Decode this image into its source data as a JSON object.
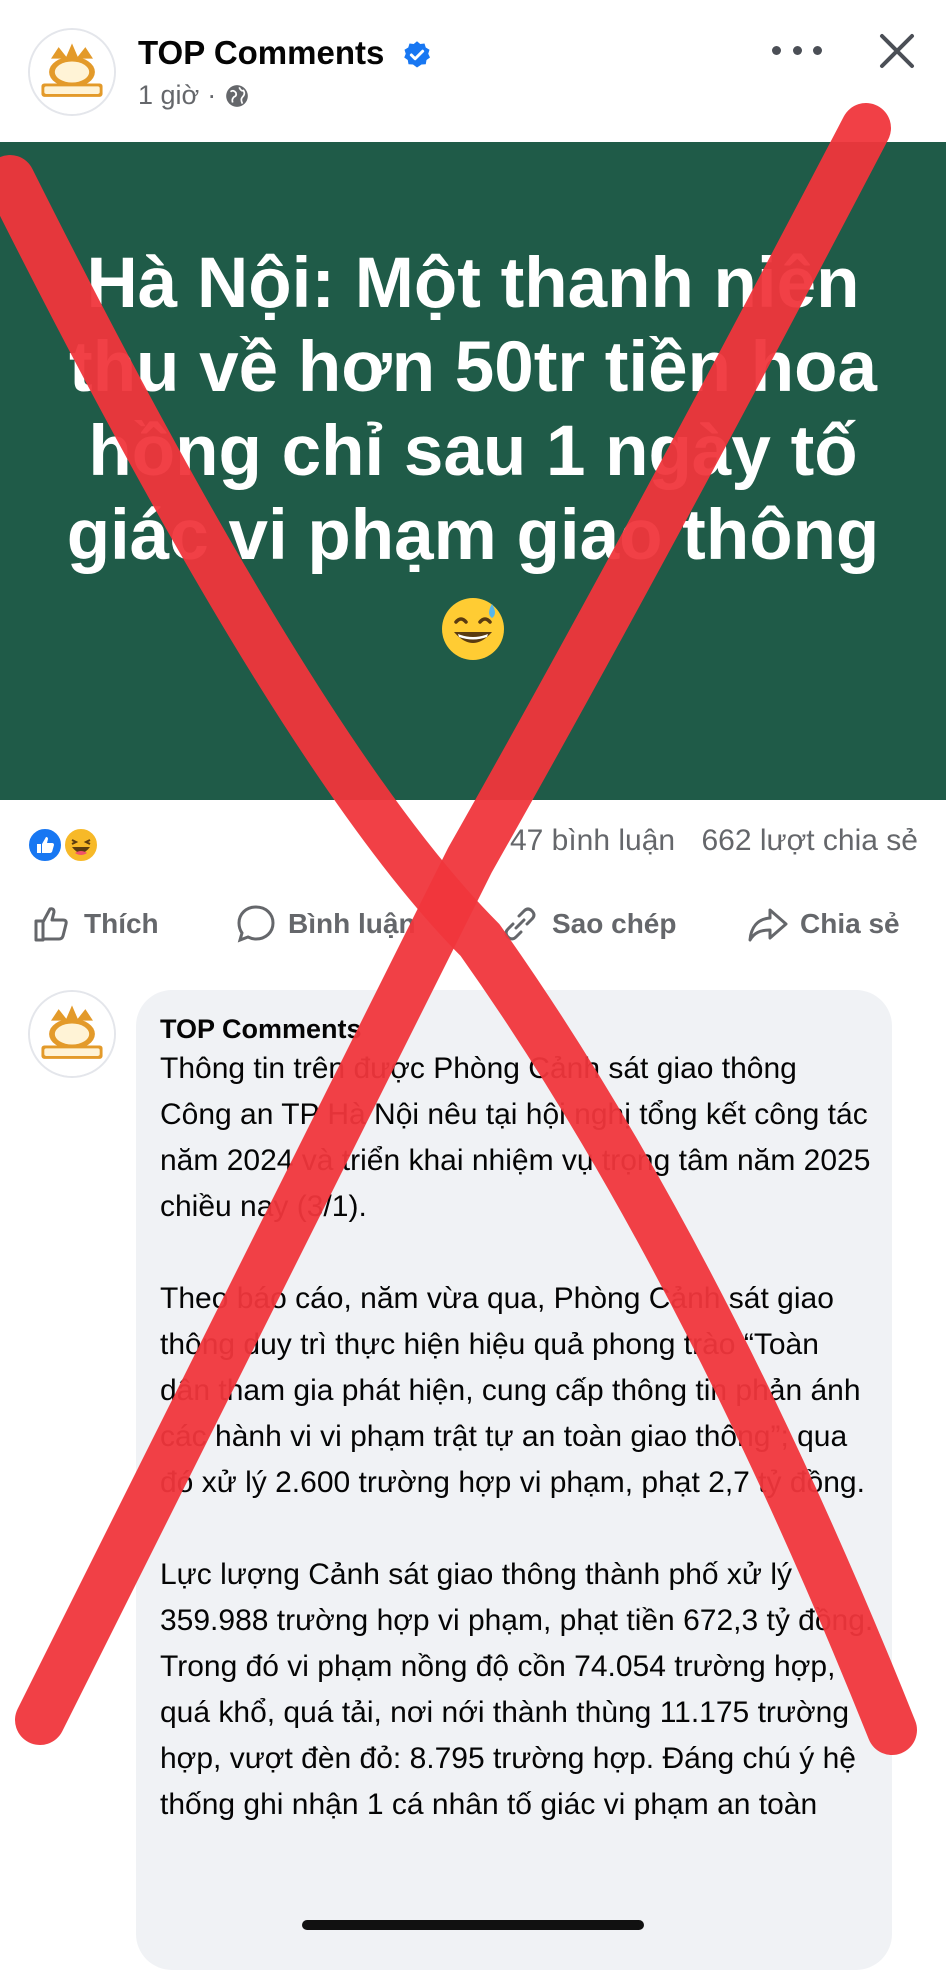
{
  "post": {
    "page_name": "TOP Comments",
    "avatar_text": "TOP COMMENTS",
    "time": "1 giờ",
    "separator": "·",
    "banner_title": "Hà Nội: Một thanh niên thu về hơn 50tr tiền hoa hồng chỉ sau 1 ngày tố giác vi phạm giao thông",
    "banner_bg": "#1f5b48"
  },
  "stats": {
    "comments": "47 bình luận",
    "shares": "662 lượt chia sẻ"
  },
  "actions": {
    "like": "Thích",
    "comment": "Bình luận",
    "copy": "Sao chép",
    "share": "Chia sẻ"
  },
  "comment": {
    "author": "TOP Comments",
    "paragraphs": [
      "Thông tin trên được Phòng Cảnh sát giao thông Công an TP Hà Nội nêu tại hội nghị tổng kết công tác năm 2024 và triển khai nhiệm vụ trọng tâm năm 2025 chiều nay (3/1).",
      "Theo báo cáo, năm vừa qua, Phòng Cảnh sát giao thông duy trì thực hiện hiệu quả phong trào “Toàn dân tham gia phát hiện, cung cấp thông tin phản ánh các hành vi vi phạm trật tự an toàn giao thông”; qua đó xử lý 2.600 trường hợp vi phạm, phạt 2,7 tỷ đồng.",
      "Lực lượng Cảnh sát giao thông thành phố xử lý 359.988 trường hợp vi phạm, phạt tiền 672,3 tỷ đồng. Trong đó vi phạm nồng độ cồn 74.054 trường hợp, quá khổ, quá tải, nơi nới thành thùng 11.175 trường hợp, vượt đèn đỏ: 8.795 trường hợp. Đáng chú ý hệ thống ghi nhận 1 cá nhân tố giác vi phạm an toàn"
    ]
  },
  "colors": {
    "accent_blue": "#1877f2",
    "cross_red": "#f0363c",
    "muted_text": "#65676b"
  }
}
